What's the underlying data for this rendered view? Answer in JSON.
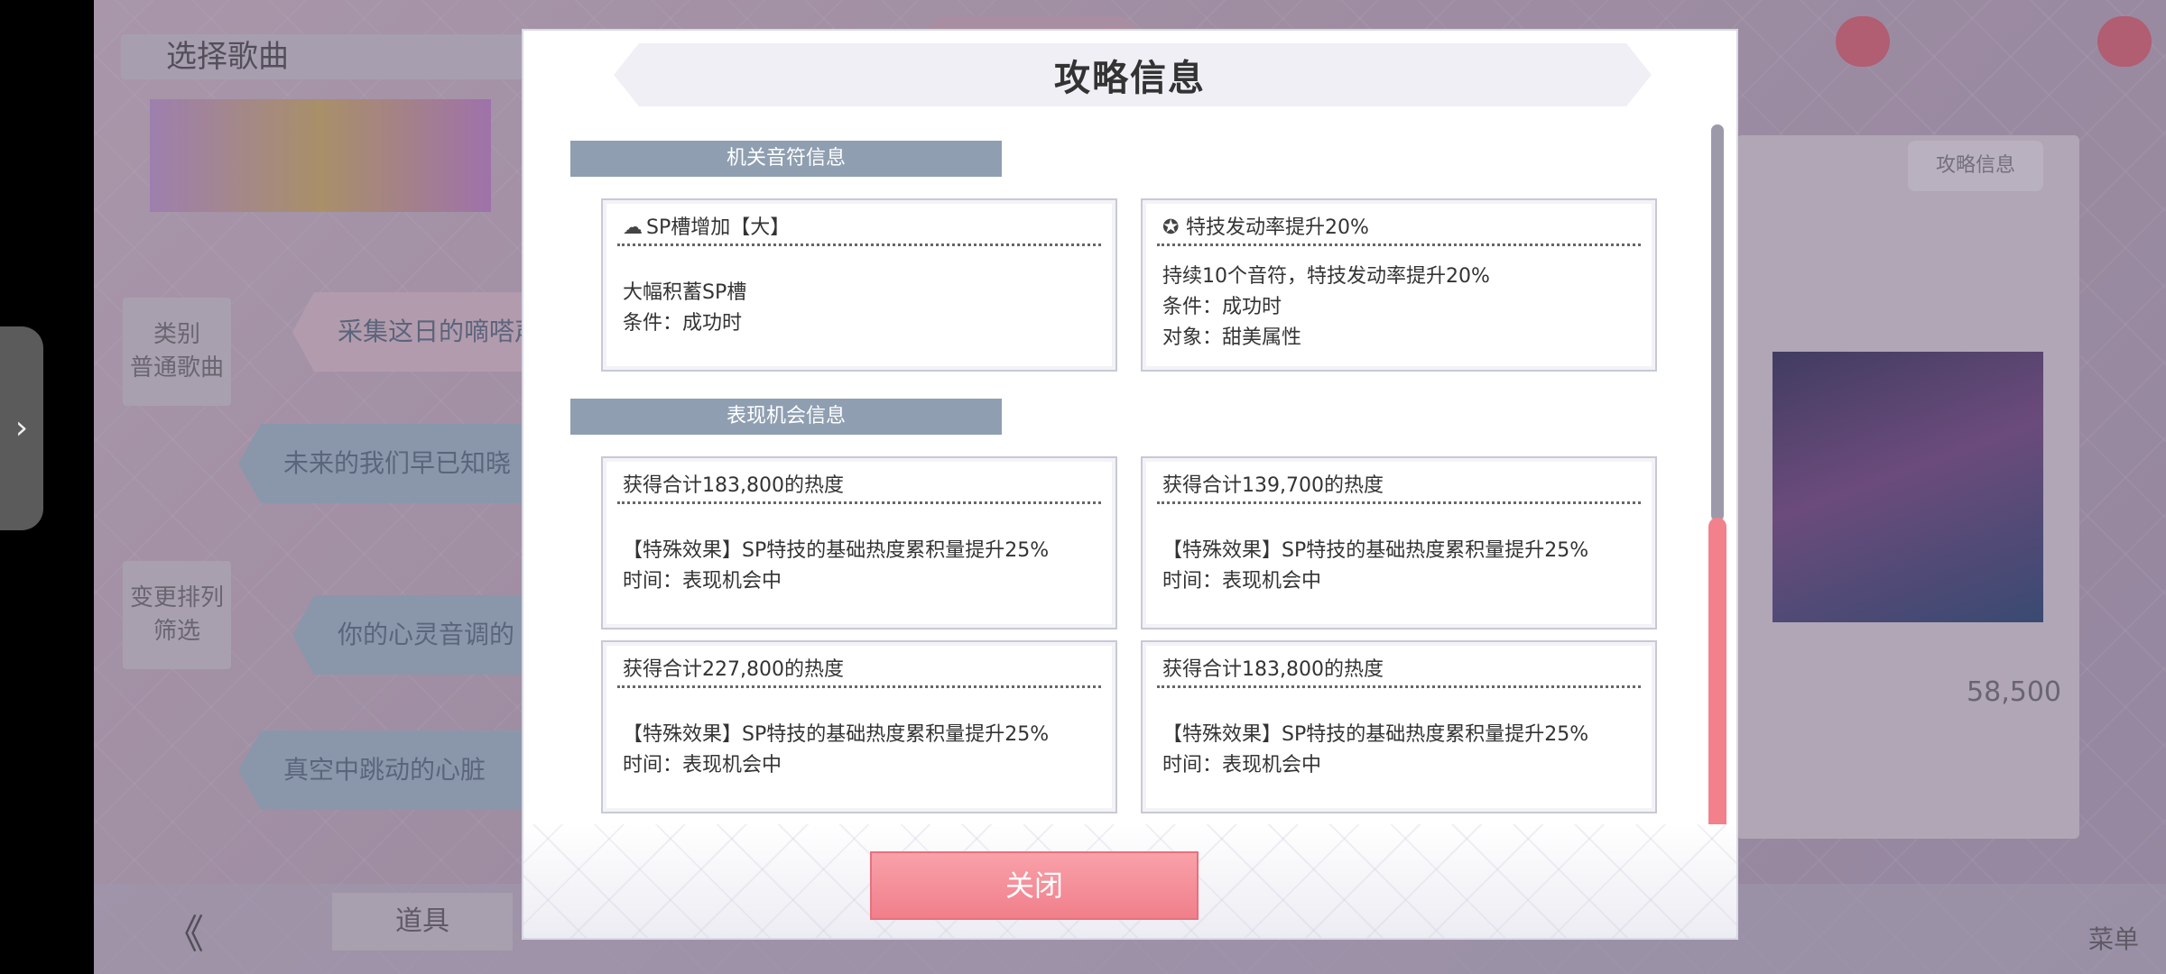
{
  "background": {
    "screen_title": "选择歌曲",
    "category_tag": "类别\n普通歌曲",
    "filter_tag": "变更排列\n筛选",
    "songs": [
      "采集这日的嘀嗒声",
      "未来的我们早已知晓",
      "你的心灵音调的",
      "真空中跳动的心脏"
    ],
    "strategy_button": "攻略信息",
    "score": "58,500",
    "bottom": {
      "back": "《",
      "props": "道具",
      "menu": "菜单"
    }
  },
  "modal": {
    "title": "攻略信息",
    "section1": {
      "header": "机关音符信息",
      "cards": [
        {
          "icon": "sp-gauge-icon",
          "glyph": "☁",
          "title": "SP槽增加【大】",
          "lines": [
            "大幅积蓄SP槽",
            "条件：成功时"
          ]
        },
        {
          "icon": "skill-rate-icon",
          "glyph": "✪",
          "title": "特技发动率提升20%",
          "lines": [
            "持续10个音符，特技发动率提升20%",
            "条件：成功时",
            "对象：甜美属性"
          ]
        }
      ]
    },
    "section2": {
      "header": "表现机会信息",
      "cards": [
        {
          "title": "获得合计183,800的热度",
          "lines": [
            "【特殊效果】SP特技的基础热度累积量提升25%",
            "时间：表现机会中"
          ]
        },
        {
          "title": "获得合计139,700的热度",
          "lines": [
            "【特殊效果】SP特技的基础热度累积量提升25%",
            "时间：表现机会中"
          ]
        },
        {
          "title": "获得合计227,800的热度",
          "lines": [
            "【特殊效果】SP特技的基础热度累积量提升25%",
            "时间：表现机会中"
          ]
        },
        {
          "title": "获得合计183,800的热度",
          "lines": [
            "【特殊效果】SP特技的基础热度累积量提升25%",
            "时间：表现机会中"
          ]
        }
      ]
    },
    "close_label": "关闭"
  }
}
